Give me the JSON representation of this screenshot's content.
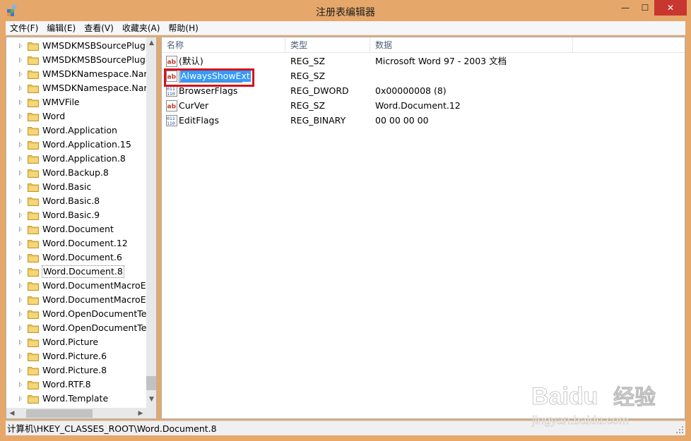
{
  "window": {
    "title": "注册表编辑器",
    "controls": {
      "minimize": "—",
      "maximize": "☐",
      "close": "✕"
    }
  },
  "menu": [
    {
      "label": "文件(F)"
    },
    {
      "label": "编辑(E)"
    },
    {
      "label": "查看(V)"
    },
    {
      "label": "收藏夹(A)"
    },
    {
      "label": "帮助(H)"
    }
  ],
  "tree": {
    "items": [
      {
        "label": "WMSDKMSBSourcePlugi"
      },
      {
        "label": "WMSDKMSBSourcePlugi"
      },
      {
        "label": "WMSDKNamespace.Nam"
      },
      {
        "label": "WMSDKNamespace.Nam"
      },
      {
        "label": "WMVFile"
      },
      {
        "label": "Word"
      },
      {
        "label": "Word.Application"
      },
      {
        "label": "Word.Application.15"
      },
      {
        "label": "Word.Application.8"
      },
      {
        "label": "Word.Backup.8"
      },
      {
        "label": "Word.Basic"
      },
      {
        "label": "Word.Basic.8"
      },
      {
        "label": "Word.Basic.9"
      },
      {
        "label": "Word.Document"
      },
      {
        "label": "Word.Document.12"
      },
      {
        "label": "Word.Document.6"
      },
      {
        "label": "Word.Document.8",
        "selected": true
      },
      {
        "label": "Word.DocumentMacroEr"
      },
      {
        "label": "Word.DocumentMacroEr"
      },
      {
        "label": "Word.OpenDocumentTex"
      },
      {
        "label": "Word.OpenDocumentTex"
      },
      {
        "label": "Word.Picture"
      },
      {
        "label": "Word.Picture.6"
      },
      {
        "label": "Word.Picture.8"
      },
      {
        "label": "Word.RTF.8"
      },
      {
        "label": "Word.Template"
      }
    ]
  },
  "values": {
    "columns": {
      "name": "名称",
      "type": "类型",
      "data": "数据"
    },
    "rows": [
      {
        "icon": "string-value-icon",
        "name": "(默认)",
        "type": "REG_SZ",
        "data": "Microsoft Word 97 - 2003 文档"
      },
      {
        "icon": "string-value-icon",
        "name": "AlwaysShowExt",
        "type": "REG_SZ",
        "data": "",
        "editing": true
      },
      {
        "icon": "binary-value-icon",
        "name": "BrowserFlags",
        "type": "REG_DWORD",
        "data": "0x00000008 (8)"
      },
      {
        "icon": "string-value-icon",
        "name": "CurVer",
        "type": "REG_SZ",
        "data": "Word.Document.12"
      },
      {
        "icon": "binary-value-icon",
        "name": "EditFlags",
        "type": "REG_BINARY",
        "data": "00 00 00 00"
      }
    ]
  },
  "statusbar": {
    "path": "计算机\\HKEY_CLASSES_ROOT\\Word.Document.8"
  },
  "watermark": {
    "brand": "Baidu",
    "cn": "经验",
    "url": "jingyan.baidu.com"
  },
  "colors": {
    "titlebar": "#e6a76a",
    "close": "#c7372f",
    "highlight": "#d3121b",
    "selection": "#3399ff"
  }
}
